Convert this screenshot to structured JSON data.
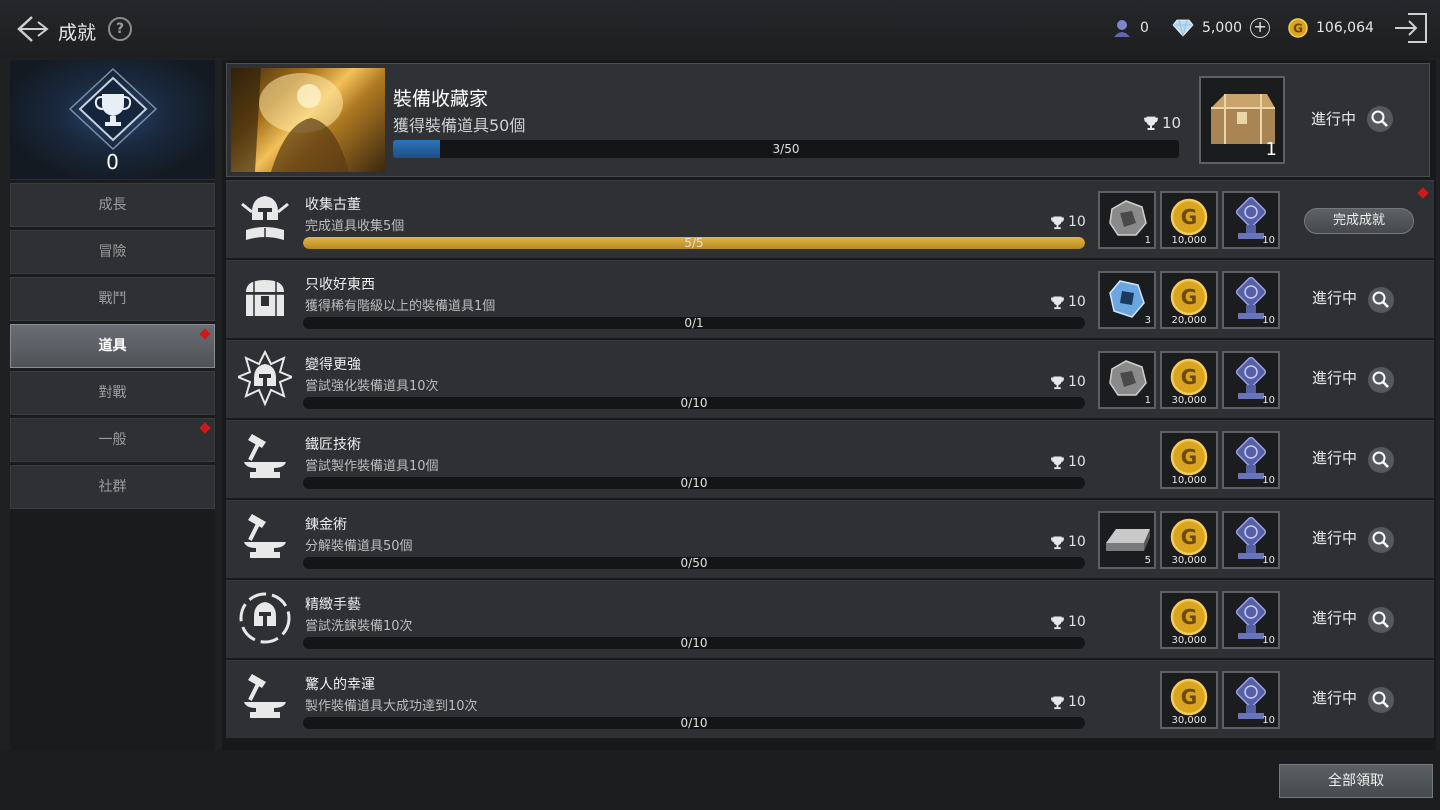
{
  "header": {
    "title": "成就",
    "help": "?",
    "currencies": {
      "tickets": "0",
      "diamonds": "5,000",
      "gold": "106,064"
    }
  },
  "sidebar": {
    "score": "0",
    "items": [
      {
        "label": "成長",
        "active": false,
        "alert": false
      },
      {
        "label": "冒險",
        "active": false,
        "alert": false
      },
      {
        "label": "戰鬥",
        "active": false,
        "alert": false
      },
      {
        "label": "道具",
        "active": true,
        "alert": true
      },
      {
        "label": "對戰",
        "active": false,
        "alert": false
      },
      {
        "label": "一般",
        "active": false,
        "alert": true
      },
      {
        "label": "社群",
        "active": false,
        "alert": false
      }
    ]
  },
  "featured": {
    "title": "裝備收藏家",
    "desc": "獲得裝備道具50個",
    "progress_text": "3/50",
    "progress": 0.06,
    "points": "10",
    "reward_qty": "1",
    "status": "進行中"
  },
  "achievements": [
    {
      "icon": "helmet-book-icon",
      "title": "收集古董",
      "desc": "完成道具收集5個",
      "progress_text": "5/5",
      "progress": 1.0,
      "points": "10",
      "rewards": [
        {
          "type": "ore-icon",
          "qty": "1"
        },
        {
          "type": "gold-coin-icon",
          "qty": "10,000"
        },
        {
          "type": "blue-medal-icon",
          "qty": "10"
        }
      ],
      "status": "完成成就",
      "complete": true
    },
    {
      "icon": "chest-icon",
      "title": "只收好東西",
      "desc": "獲得稀有階級以上的裝備道具1個",
      "progress_text": "0/1",
      "progress": 0,
      "points": "10",
      "rewards": [
        {
          "type": "crystal-icon",
          "qty": "3"
        },
        {
          "type": "gold-coin-icon",
          "qty": "20,000"
        },
        {
          "type": "blue-medal-icon",
          "qty": "10"
        }
      ],
      "status": "進行中",
      "complete": false
    },
    {
      "icon": "helmet-burst-icon",
      "title": "變得更強",
      "desc": "嘗試強化裝備道具10次",
      "progress_text": "0/10",
      "progress": 0,
      "points": "10",
      "rewards": [
        {
          "type": "ore-icon",
          "qty": "1"
        },
        {
          "type": "gold-coin-icon",
          "qty": "30,000"
        },
        {
          "type": "blue-medal-icon",
          "qty": "10"
        }
      ],
      "status": "進行中",
      "complete": false
    },
    {
      "icon": "anvil-icon",
      "title": "鐵匠技術",
      "desc": "嘗試製作裝備道具10個",
      "progress_text": "0/10",
      "progress": 0,
      "points": "10",
      "rewards": [
        {
          "type": "gold-coin-icon",
          "qty": "10,000"
        },
        {
          "type": "blue-medal-icon",
          "qty": "10"
        }
      ],
      "status": "進行中",
      "complete": false
    },
    {
      "icon": "anvil-icon",
      "title": "鍊金術",
      "desc": "分解裝備道具50個",
      "progress_text": "0/50",
      "progress": 0,
      "points": "10",
      "rewards": [
        {
          "type": "ingot-icon",
          "qty": "5"
        },
        {
          "type": "gold-coin-icon",
          "qty": "30,000"
        },
        {
          "type": "blue-medal-icon",
          "qty": "10"
        }
      ],
      "status": "進行中",
      "complete": false
    },
    {
      "icon": "helmet-swirl-icon",
      "title": "精緻手藝",
      "desc": "嘗試洗鍊裝備10次",
      "progress_text": "0/10",
      "progress": 0,
      "points": "10",
      "rewards": [
        {
          "type": "gold-coin-icon",
          "qty": "30,000"
        },
        {
          "type": "blue-medal-icon",
          "qty": "10"
        }
      ],
      "status": "進行中",
      "complete": false
    },
    {
      "icon": "anvil-icon",
      "title": "驚人的幸運",
      "desc": "製作裝備道具大成功達到10次",
      "progress_text": "0/10",
      "progress": 0,
      "points": "10",
      "rewards": [
        {
          "type": "gold-coin-icon",
          "qty": "30,000"
        },
        {
          "type": "blue-medal-icon",
          "qty": "10"
        }
      ],
      "status": "進行中",
      "complete": false
    }
  ],
  "claim_all": "全部領取",
  "colors": {
    "accent_gold": "#e2b545",
    "progress_blue": "#2c74b8",
    "alert_red": "#d01a1a"
  }
}
